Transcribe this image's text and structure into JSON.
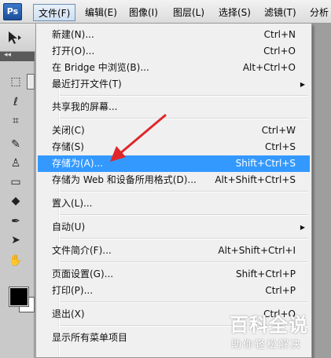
{
  "app": {
    "logo": "Ps"
  },
  "menubar": [
    {
      "label": "文件(F)",
      "active": true
    },
    {
      "label": "编辑(E)"
    },
    {
      "label": "图像(I)"
    },
    {
      "label": "图层(L)"
    },
    {
      "label": "选择(S)"
    },
    {
      "label": "滤镜(T)"
    },
    {
      "label": "分析"
    }
  ],
  "file_menu": {
    "items": [
      {
        "label": "新建(N)...",
        "shortcut": "Ctrl+N"
      },
      {
        "label": "打开(O)...",
        "shortcut": "Ctrl+O"
      },
      {
        "label": "在 Bridge 中浏览(B)...",
        "shortcut": "Alt+Ctrl+O"
      },
      {
        "label": "最近打开文件(T)",
        "submenu": true
      },
      {
        "label": "共享我的屏幕..."
      },
      {
        "label": "关闭(C)",
        "shortcut": "Ctrl+W"
      },
      {
        "label": "存储(S)",
        "shortcut": "Ctrl+S"
      },
      {
        "label": "存储为(A)...",
        "shortcut": "Shift+Ctrl+S",
        "highlighted": true
      },
      {
        "label": "存储为 Web 和设备所用格式(D)...",
        "shortcut": "Alt+Shift+Ctrl+S"
      },
      {
        "label": "置入(L)..."
      },
      {
        "label": "自动(U)",
        "submenu": true
      },
      {
        "label": "文件简介(F)...",
        "shortcut": "Alt+Shift+Ctrl+I"
      },
      {
        "label": "页面设置(G)...",
        "shortcut": "Shift+Ctrl+P"
      },
      {
        "label": "打印(P)...",
        "shortcut": "Ctrl+P"
      },
      {
        "label": "退出(X)",
        "shortcut": "Ctrl+Q"
      },
      {
        "label": "显示所有菜单项目"
      }
    ],
    "submenu_glyph": "▶"
  },
  "toolbar": {
    "collapse_glyph": "◂◂"
  },
  "watermark": {
    "main": "百科全说",
    "sub": "助你轻松解决"
  },
  "colors": {
    "highlight": "#3399ff",
    "arrow": "#e0262a"
  }
}
